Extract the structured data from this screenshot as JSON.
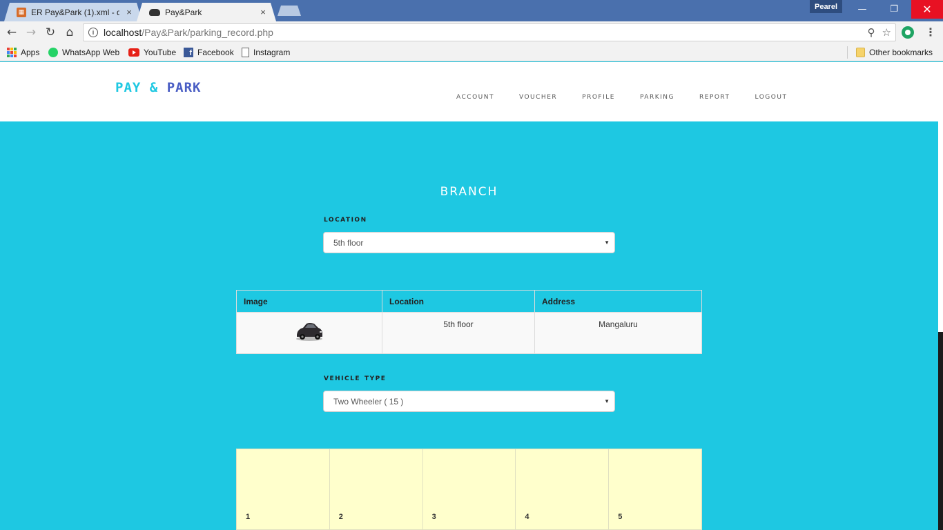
{
  "browser": {
    "tabs": [
      {
        "title": "ER Pay&Park (1).xml - dra",
        "close": "×"
      },
      {
        "title": "Pay&Park",
        "close": "×"
      }
    ],
    "profile_name": "Pearel",
    "window_controls": {
      "minimize": "—",
      "restore": "❐",
      "close": "✕"
    },
    "url_host": "localhost",
    "url_path": "/Pay&Park/parking_record.php",
    "bookmarks": [
      "Apps",
      "WhatsApp Web",
      "YouTube",
      "Facebook",
      "Instagram"
    ],
    "other_bookmarks": "Other bookmarks"
  },
  "site": {
    "brand_pay": "PAY",
    "brand_amp": "&",
    "brand_park": "PARK",
    "nav": [
      "Account",
      "Voucher",
      "Profile",
      "Parking",
      "Report",
      "Logout"
    ]
  },
  "main": {
    "title": "Branch",
    "location_label": "Location",
    "location_selected": "5th floor",
    "table": {
      "headers": [
        "Image",
        "Location",
        "Address"
      ],
      "rows": [
        {
          "location": "5th floor",
          "address": "Mangaluru"
        }
      ]
    },
    "vehicle_label": "Vehicle type",
    "vehicle_selected": "Two Wheeler ( 15 )",
    "slots": [
      "1",
      "2",
      "3",
      "4",
      "5"
    ]
  },
  "colors": {
    "page_bg": "#1ec8e2",
    "brand_pay": "#1ec8e2",
    "brand_park": "#4a5ec4",
    "slot_bg": "#ffffcc",
    "titlebar": "#4a70ad"
  }
}
